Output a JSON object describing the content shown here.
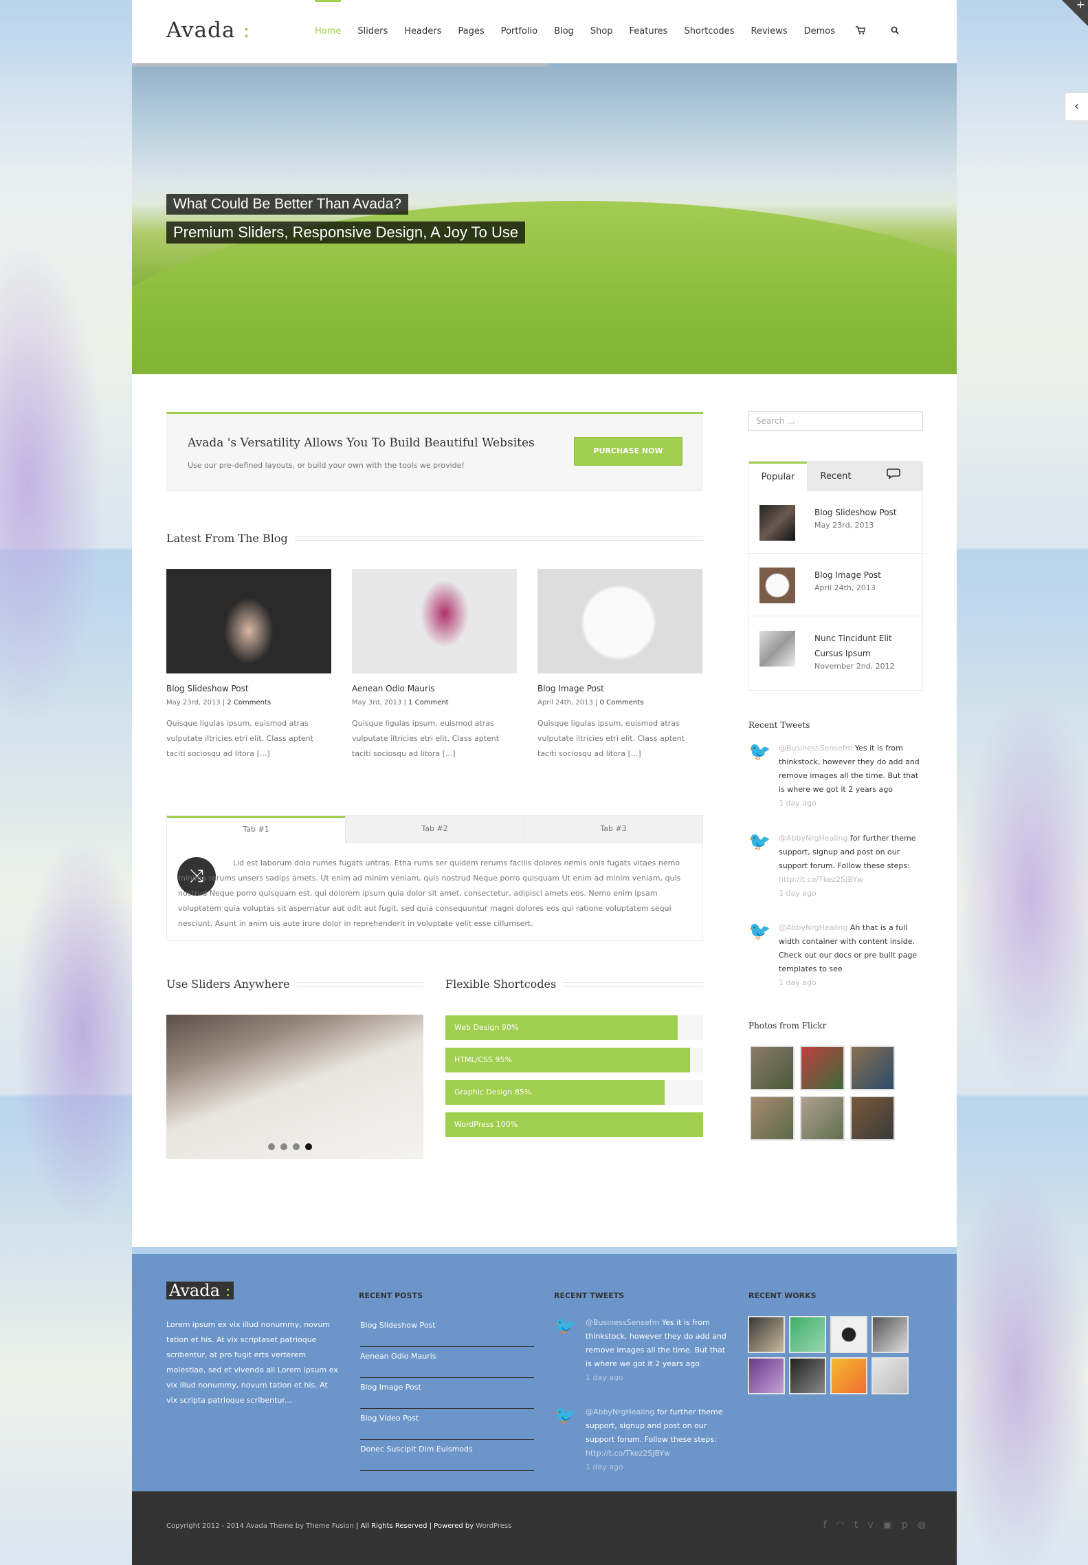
{
  "brand": {
    "logo": "Avada",
    "logo_mark": " :"
  },
  "nav": {
    "items": [
      "Home",
      "Sliders",
      "Headers",
      "Pages",
      "Portfolio",
      "Blog",
      "Shop",
      "Features",
      "Shortcodes",
      "Reviews",
      "Demos"
    ],
    "cart_icon": "cart-icon",
    "search_icon": "search-icon"
  },
  "hero": {
    "caption1": "What Could Be Better Than Avada?",
    "caption2": "Premium Sliders, Responsive Design, A Joy To Use"
  },
  "tagline": {
    "title": "Avada 's Versatility Allows You To Build Beautiful Websites",
    "text": "Use our pre-defined layouts, or build your own with the tools we provide!",
    "button": "PURCHASE NOW"
  },
  "blog": {
    "heading": "Latest From The Blog",
    "posts": [
      {
        "title": "Blog Slideshow Post",
        "date": "May 23rd, 2013",
        "comments": "2 Comments",
        "excerpt": "Quisque ligulas ipsum, euismod atras vulputate iltricies etri elit. Class aptent taciti sociosqu ad litora [...]"
      },
      {
        "title": "Aenean Odio Mauris",
        "date": "May 3rd, 2013",
        "comments": "1 Comment",
        "excerpt": "Quisque ligulas ipsum, euismod atras vulputate iltricies etri elit. Class aptent taciti sociosqu ad litora [...]"
      },
      {
        "title": "Blog Image Post",
        "date": "April 24th, 2013",
        "comments": "0 Comments",
        "excerpt": "Quisque ligulas ipsum, euismod atras vulputate iltricies etri elit. Class aptent taciti sociosqu ad litora [...]"
      }
    ]
  },
  "tabs": {
    "labels": [
      "Tab #1",
      "Tab #2",
      "Tab #3"
    ],
    "content": "Lid est laborum dolo rumes fugats untras. Etha rums ser quidem rerums facilis dolores nemis onis fugats vitaes nemo minima rerums unsers sadips amets. Ut enim ad minim veniam, quis nostrud Neque porro quisquam Ut enim ad minim veniam, quis nostrud Neque porro quisquam est, qui dolorem ipsum quia dolor sit amet, consectetur, adipisci amets eos. Nemo enim ipsam voluptatem quia voluptas sit aspernatur aut odit aut fugit, sed quia consequuntur magni dolores eos qui ratione voluptatem sequi nesciunt. Asunt in anim uis aute irure dolor in reprehenderit in voluptate velit esse cillumsert."
  },
  "sliders_heading": "Use Sliders Anywhere",
  "shortcodes": {
    "heading": "Flexible Shortcodes",
    "bars": [
      {
        "label": "Web Design 90%",
        "value": 90
      },
      {
        "label": "HTML/CSS 95%",
        "value": 95
      },
      {
        "label": "Graphic Design 85%",
        "value": 85
      },
      {
        "label": "WordPress 100%",
        "value": 100
      }
    ]
  },
  "sidebar": {
    "search_placeholder": "Search ...",
    "tabs": [
      "Popular",
      "Recent"
    ],
    "comments_icon": "comments-icon",
    "posts": [
      {
        "title": "Blog Slideshow Post",
        "date": "May 23rd, 2013"
      },
      {
        "title": "Blog Image Post",
        "date": "April 24th, 2013"
      },
      {
        "title": "Nunc Tincidunt Elit Cursus Ipsum",
        "date": "November 2nd, 2012"
      }
    ],
    "tweets_heading": "Recent Tweets",
    "tweets": [
      {
        "user": "@BusinessSensefm",
        "text": "Yes it is from thinkstock, however they do add and remove images all the time. But that is where we got it 2 years ago",
        "link": "",
        "ago": "1 day ago"
      },
      {
        "user": "@AbbyNrgHealing",
        "text": "for further theme support, signup and post on our support forum. Follow these steps:",
        "link": "http://t.co/Tkez2SJBYw",
        "ago": "1 day ago"
      },
      {
        "user": "@AbbyNrgHealing",
        "text": "Ah that is a full width container with content inside. Check out our docs or pre built page templates to see",
        "link": "",
        "ago": "1 day ago"
      }
    ],
    "flickr_heading": "Photos from Flickr"
  },
  "footer": {
    "logo": "Avada",
    "logo_mark": " :",
    "about": "Lorem ipsum ex vix illud nonummy, novum tation et his. At vix scriptaset patrioque scribentur, at pro fugit erts verterem molestiae, sed et vivendo ali Lorem ipsum ex vix illud nonummy, novum tation et his. At vix scripta patrioque scribentur...",
    "recent_posts_heading": "RECENT POSTS",
    "recent_posts": [
      "Blog Slideshow Post",
      "Aenean Odio Mauris",
      "Blog Image Post",
      "Blog Video Post",
      "Donec Suscipit Dim Euismods"
    ],
    "recent_tweets_heading": "RECENT TWEETS",
    "tweets": [
      {
        "user": "@BusinessSensefm",
        "text": "Yes it is from thinkstock, however they do add and remove images all the time. But that is where we got it 2 years ago",
        "link": "",
        "ago": "1 day ago"
      },
      {
        "user": "@AbbyNrgHealing",
        "text": "for further theme support, signup and post on our support forum. Follow these steps:",
        "link": "http://t.co/Tkez2SJBYw",
        "ago": "1 day ago"
      }
    ],
    "recent_works_heading": "RECENT WORKS"
  },
  "copyright": {
    "prefix": "Copyright 2012 - 2014 Avada Theme by",
    "author": "Theme Fusion",
    "mid": "| All Rights Reserved | Powered by",
    "platform": "WordPress"
  },
  "social_icons": [
    "facebook-icon",
    "rss-icon",
    "twitter-icon",
    "vimeo-icon",
    "instagram-icon",
    "pinterest-icon",
    "dribbble-icon"
  ],
  "colors": {
    "accent": "#a0ce4e",
    "footer_bg": "#6c95c9",
    "copyright_bg": "#333333"
  }
}
